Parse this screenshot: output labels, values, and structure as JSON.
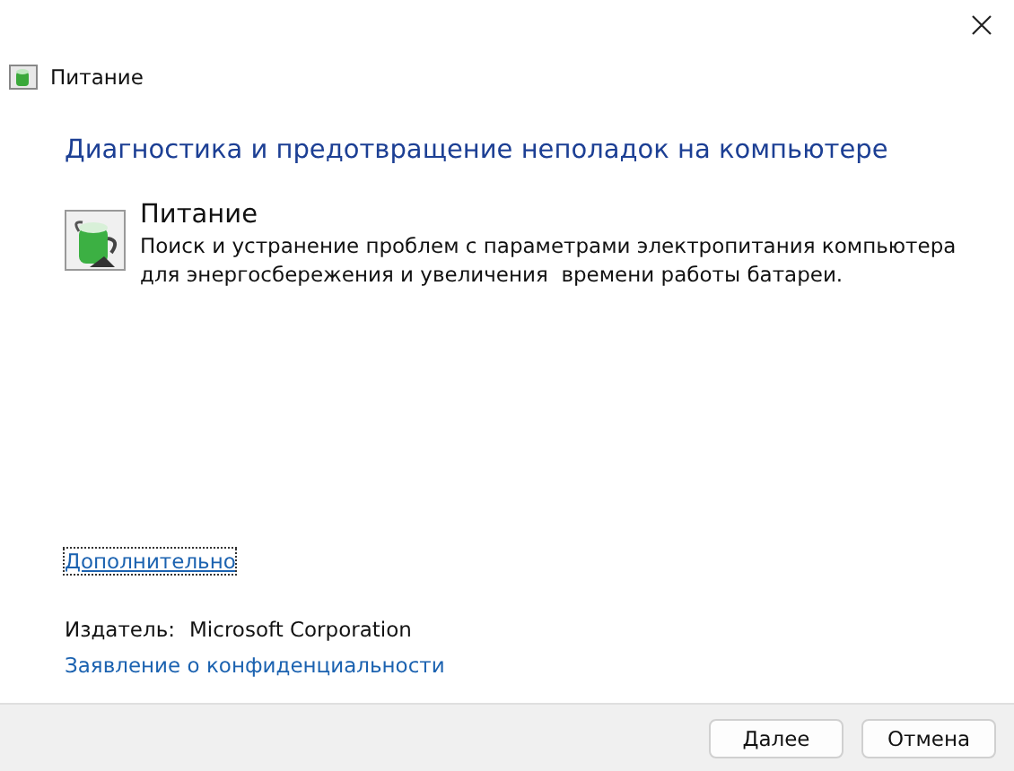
{
  "window": {
    "title": "Питание"
  },
  "heading": "Диагностика и предотвращение неполадок на компьютере",
  "troubleshooter": {
    "name": "Питание",
    "description": "Поиск и устранение проблем с параметрами электропитания компьютера для энергосбережения и увеличения  времени работы батареи."
  },
  "advanced_link": "Дополнительно",
  "publisher": {
    "label": "Издатель:",
    "value": "Microsoft Corporation"
  },
  "privacy_link": "Заявление о конфиденциальности",
  "buttons": [
    "Далее",
    "Отмена"
  ]
}
